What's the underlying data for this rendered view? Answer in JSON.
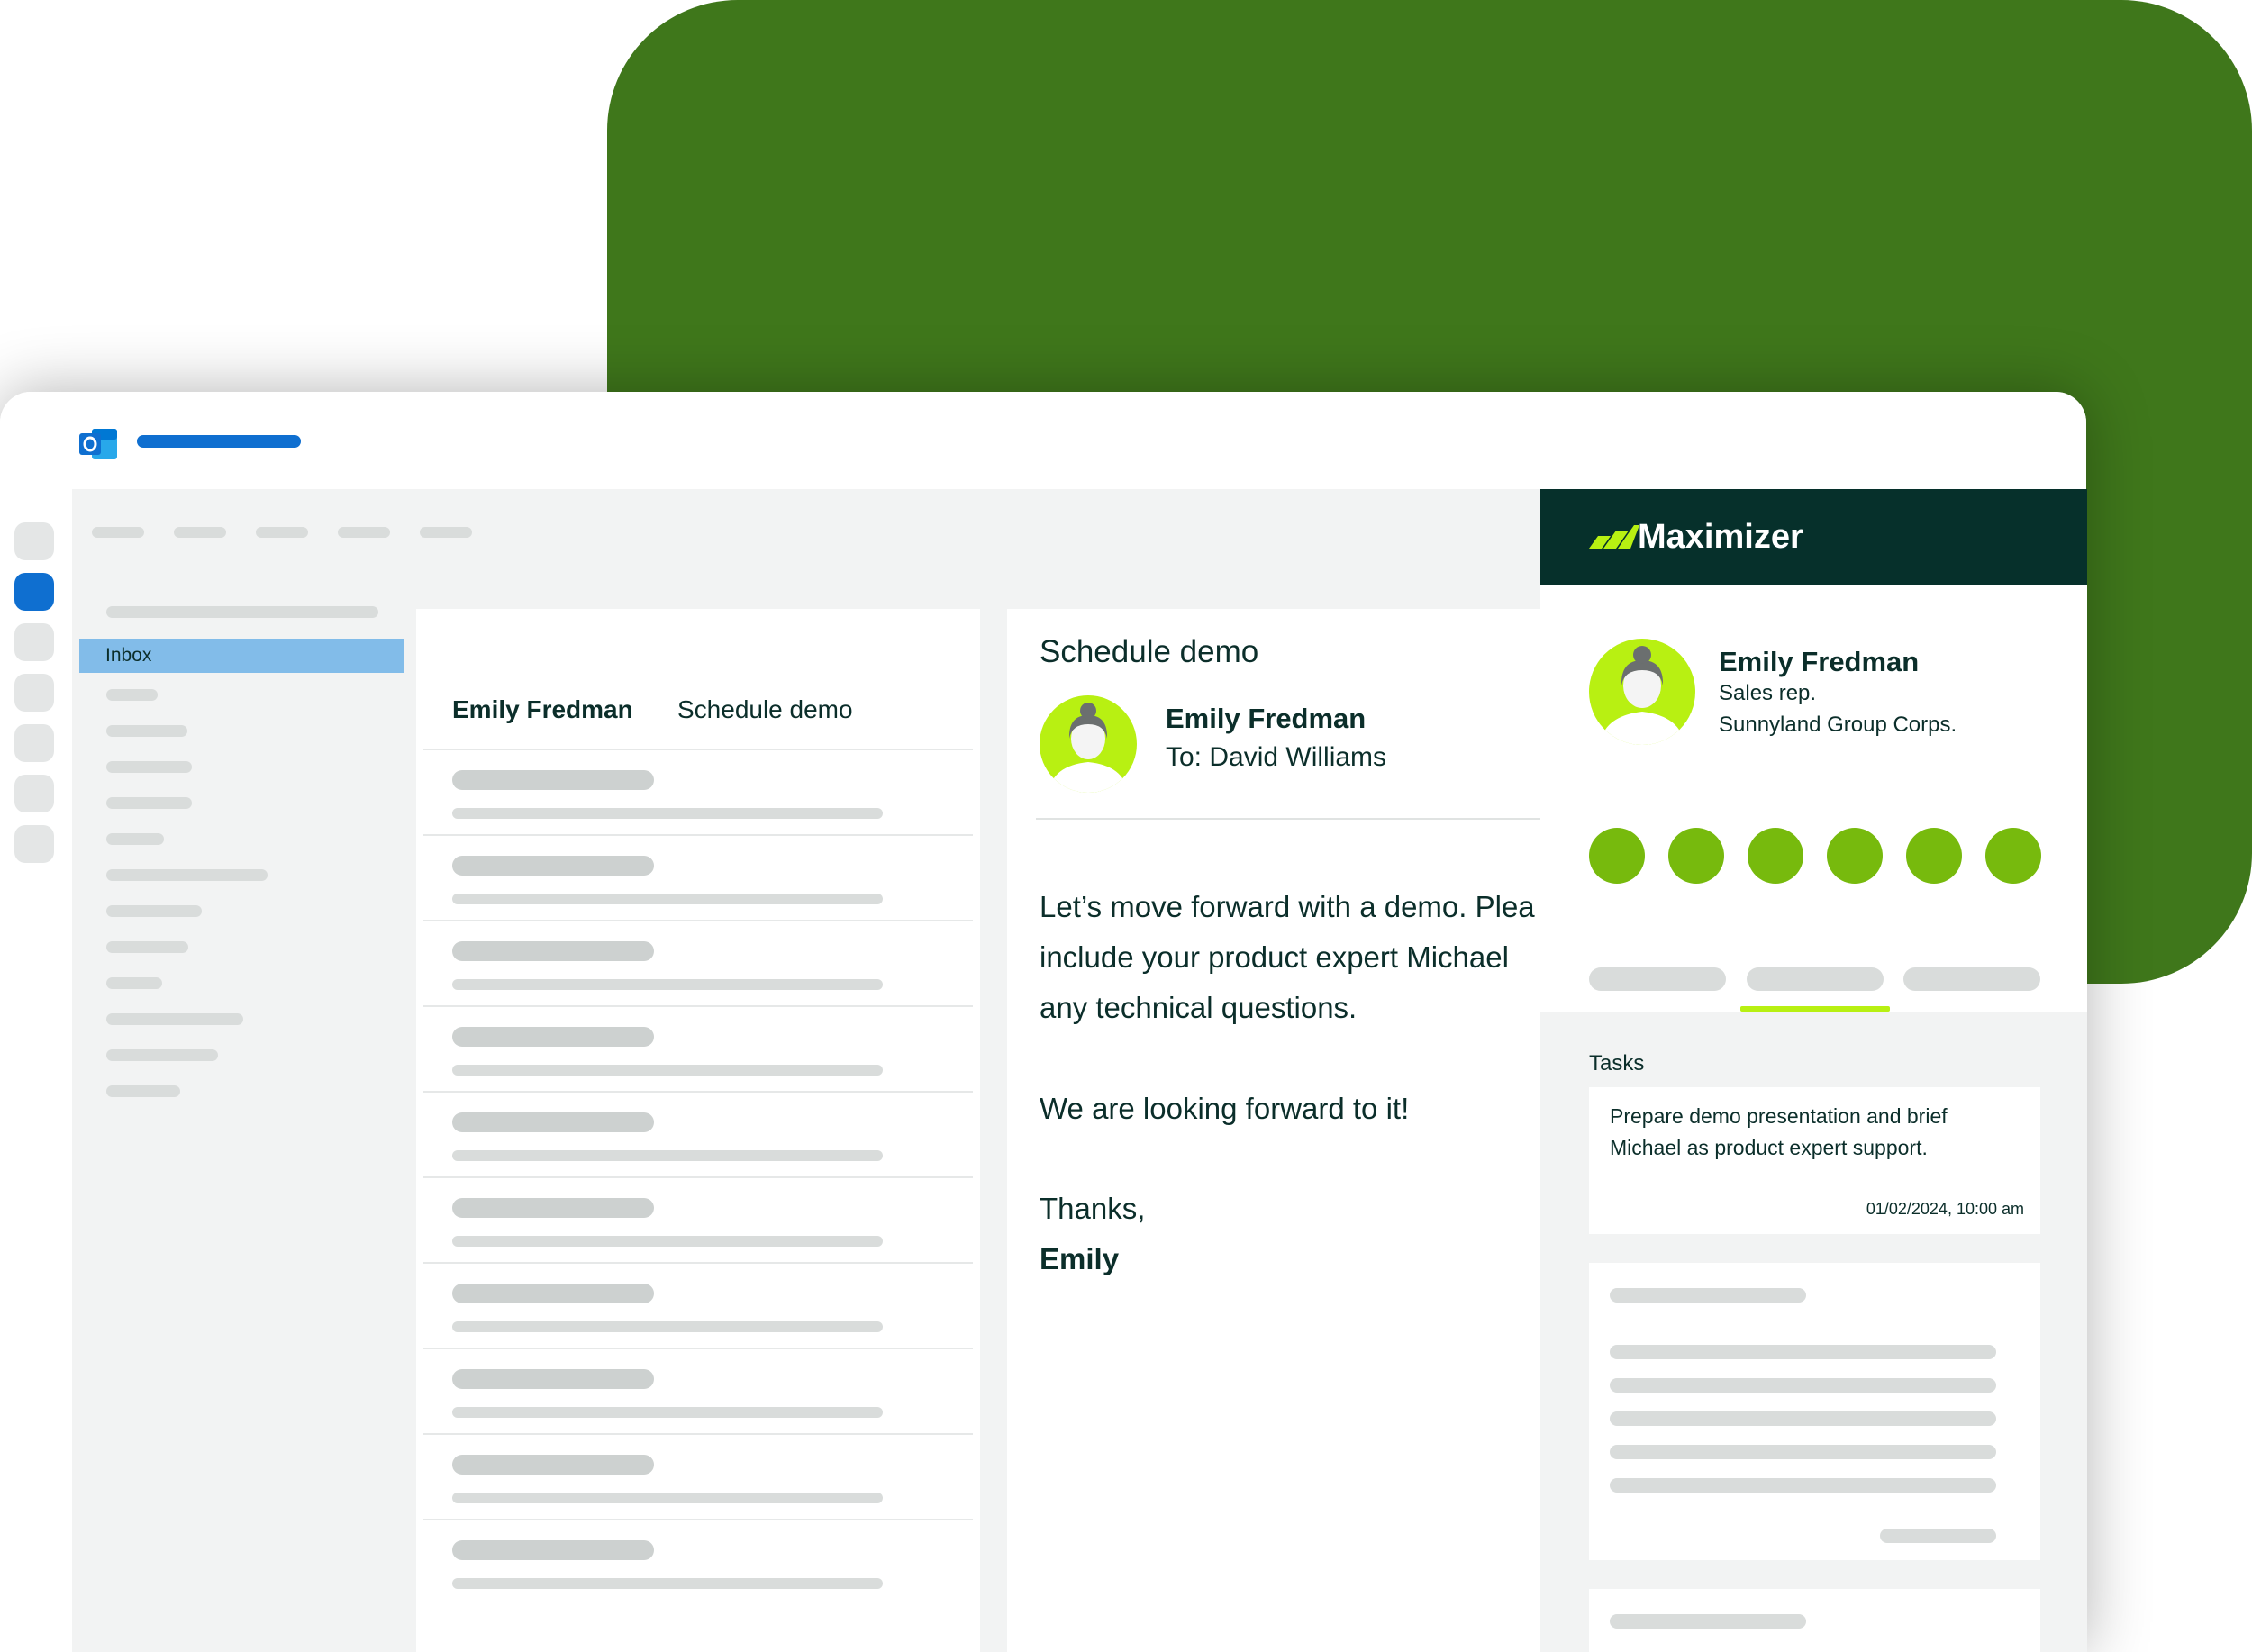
{
  "folders": {
    "inbox_label": "Inbox"
  },
  "message_list": {
    "first_item": {
      "sender": "Emily Fredman",
      "subject": "Schedule demo"
    }
  },
  "reading_pane": {
    "subject": "Schedule demo",
    "from": "Emily Fredman",
    "to": "To:  David Williams",
    "body_lines": [
      "Let’s move forward with a demo. Plea",
      "include your product expert Michael",
      "any technical questions.",
      "We are looking forward to it!",
      "Thanks,",
      "Emily"
    ]
  },
  "maximizer": {
    "brand": "Maximizer",
    "contact": {
      "name": "Emily Fredman",
      "role": "Sales rep.",
      "company": "Sunnyland Group Corps."
    },
    "tasks_title": "Tasks",
    "task": {
      "line1": "Prepare demo presentation and brief",
      "line2": "Michael as product expert support.",
      "date": "01/02/2024, 10:00 am"
    }
  },
  "colors": {
    "background_green": "#3f771b",
    "outlook_blue": "#0f6fd0",
    "selection_blue": "#82bce9",
    "maximizer_dark": "#06302b",
    "maximizer_lime": "#b8f012",
    "action_green": "#77ba0d"
  },
  "icons": {
    "app_icon": "outlook-icon",
    "avatar": "avatar-woman-icon",
    "brand_mark": "maximizer-logo-icon"
  }
}
